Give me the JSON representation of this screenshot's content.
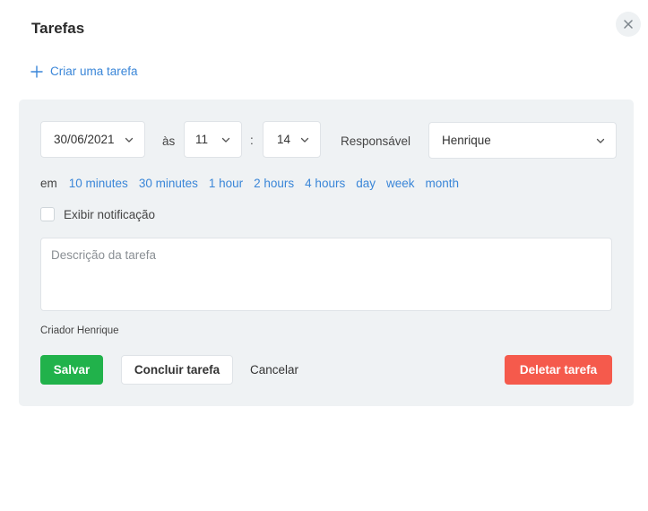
{
  "header": {
    "title": "Tarefas",
    "close_icon": "close-icon"
  },
  "create_task": {
    "icon": "plus-icon",
    "label": "Criar uma tarefa"
  },
  "form": {
    "date": {
      "value": "30/06/2021",
      "icon": "chevron-down-icon"
    },
    "at_label": "às",
    "hour": {
      "value": "11",
      "icon": "chevron-down-icon"
    },
    "colon": ":",
    "minute": {
      "value": "14",
      "icon": "chevron-down-icon"
    },
    "responsible_label": "Responsável",
    "responsible": {
      "value": "Henrique",
      "icon": "chevron-down-icon"
    },
    "quick_times": {
      "prefix": "em",
      "options": [
        "10 minutes",
        "30 minutes",
        "1 hour",
        "2 hours",
        "4 hours",
        "day",
        "week",
        "month"
      ]
    },
    "notification": {
      "label": "Exibir notificação",
      "checked": false
    },
    "description": {
      "placeholder": "Descrição da tarefa",
      "value": ""
    },
    "creator": "Criador Henrique"
  },
  "actions": {
    "save": "Salvar",
    "conclude": "Concluir tarefa",
    "cancel": "Cancelar",
    "delete": "Deletar tarefa"
  },
  "colors": {
    "accent": "#3a86d8",
    "save": "#21b24b",
    "delete": "#f55a4c",
    "panel": "#eff2f4"
  }
}
